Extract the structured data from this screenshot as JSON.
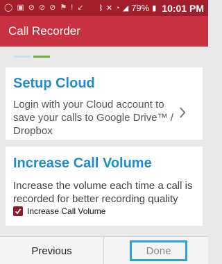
{
  "status_bar": {
    "battery": "79%",
    "time": "10:01 PM",
    "icons": [
      "whatsapp-icon",
      "image-icon",
      "missed-call-icon",
      "missed-call-icon",
      "missed-call-icon",
      "flag-icon",
      "alert-icon",
      "missed-call-icon",
      "bluetooth-icon",
      "mute-icon",
      "wifi-icon",
      "signal-icon",
      "battery-icon"
    ]
  },
  "app_bar": {
    "title": "Call Recorder"
  },
  "pager": {
    "active_index": 1,
    "colors": [
      "#c7e0ee",
      "#7aa63a"
    ]
  },
  "cards": [
    {
      "title": "Setup Cloud",
      "description": "Login with your Cloud account to save your calls to Google Drive™ / Dropbox"
    },
    {
      "title": "Increase Call Volume",
      "description": "Increase the volume each time a call is recorded for better recording quality",
      "checkbox": {
        "label": "Increase Call Volume",
        "checked": true
      }
    }
  ],
  "bottom_bar": {
    "previous_label": "Previous",
    "done_label": "Done"
  },
  "colors": {
    "status_bar": "#a31e2b",
    "app_bar": "#c8313f",
    "card_title": "#1f8ccf",
    "focus_outline": "#28a3dc",
    "checkbox": "#8a1c24"
  }
}
